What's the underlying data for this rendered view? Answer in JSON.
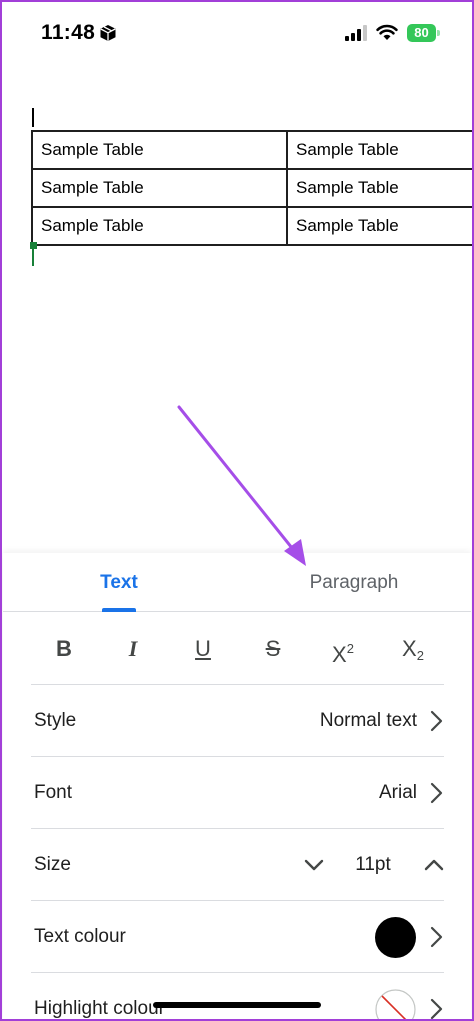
{
  "status_bar": {
    "time": "11:48",
    "battery_level": "80",
    "battery_color": "#34c759"
  },
  "document": {
    "table": [
      [
        "Sample Table",
        "Sample Table"
      ],
      [
        "Sample Table",
        "Sample Table"
      ],
      [
        "Sample Table",
        "Sample Table"
      ]
    ]
  },
  "format_panel": {
    "tabs": [
      {
        "label": "Text",
        "active": true
      },
      {
        "label": "Paragraph",
        "active": false
      }
    ],
    "accent_color": "#1a73e8",
    "buttons": [
      {
        "name": "bold",
        "glyph": "B"
      },
      {
        "name": "italic",
        "glyph": "I"
      },
      {
        "name": "underline",
        "glyph": "U"
      },
      {
        "name": "strikethrough",
        "glyph": "S"
      },
      {
        "name": "superscript",
        "glyph": "X",
        "mark": "2"
      },
      {
        "name": "subscript",
        "glyph": "X",
        "mark": "2"
      }
    ],
    "style": {
      "label": "Style",
      "value": "Normal text"
    },
    "font": {
      "label": "Font",
      "value": "Arial"
    },
    "size": {
      "label": "Size",
      "value": "11pt"
    },
    "text_colour": {
      "label": "Text colour",
      "color": "#000000"
    },
    "highlight_colour": {
      "label": "Highlight colour",
      "color": "none"
    }
  },
  "annotation": {
    "arrow_color": "#a54ee8"
  }
}
